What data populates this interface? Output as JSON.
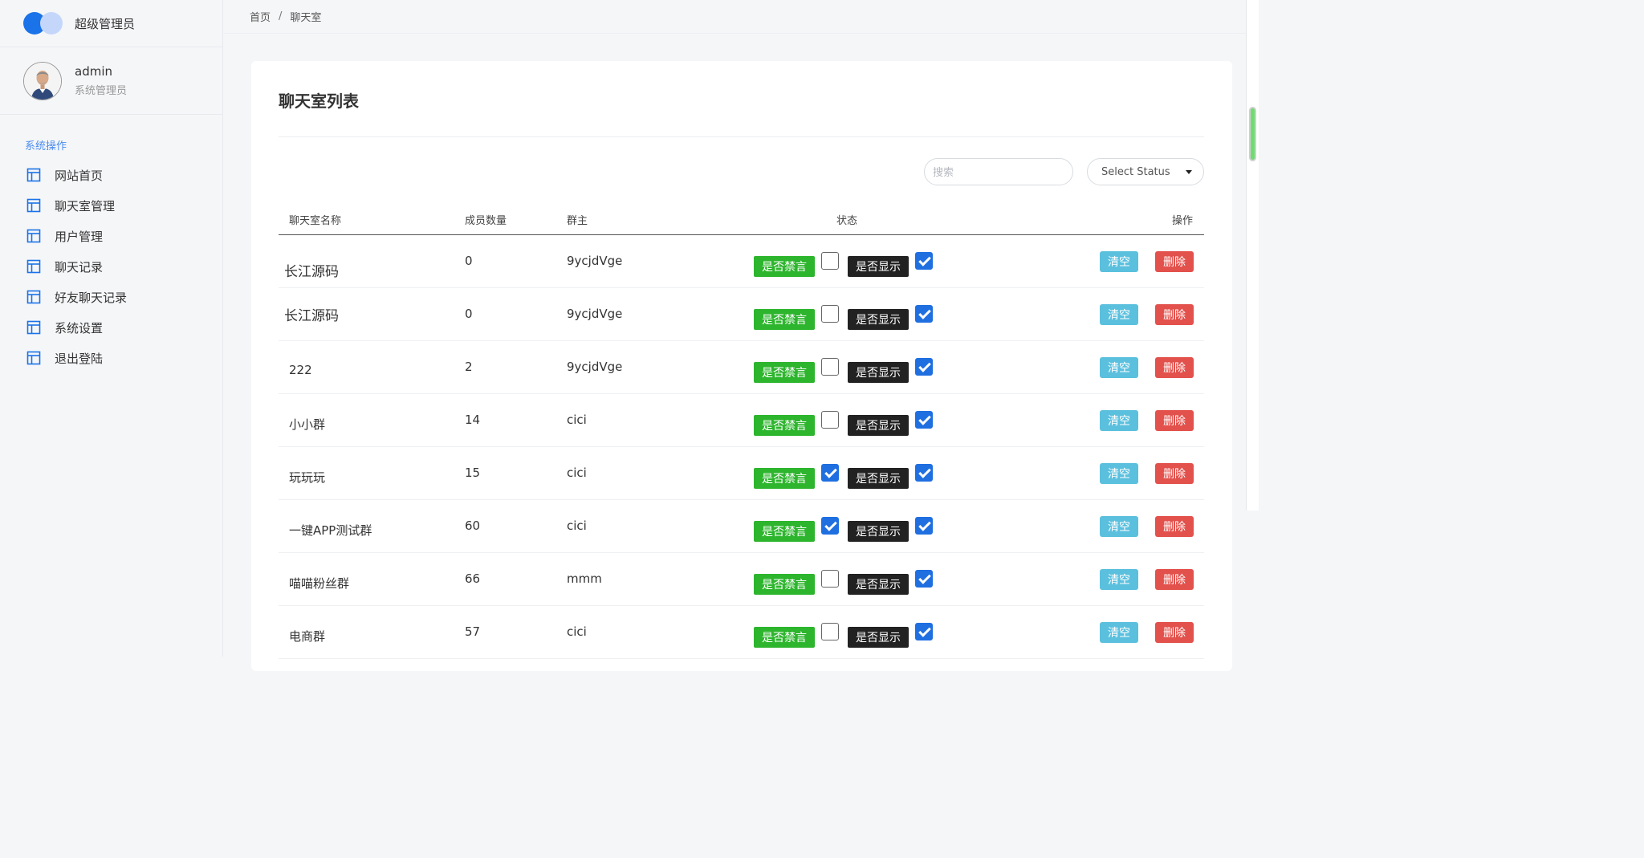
{
  "brand": {
    "name": "超级管理员"
  },
  "profile": {
    "name": "admin",
    "role": "系统管理员"
  },
  "sidebar": {
    "section_title": "系统操作",
    "items": [
      {
        "label": "网站首页"
      },
      {
        "label": "聊天室管理"
      },
      {
        "label": "用户管理"
      },
      {
        "label": "聊天记录"
      },
      {
        "label": "好友聊天记录"
      },
      {
        "label": "系统设置"
      },
      {
        "label": "退出登陆"
      }
    ]
  },
  "breadcrumb": {
    "home": "首页",
    "separator": "/",
    "current": "聊天室"
  },
  "page": {
    "title": "聊天室列表"
  },
  "filters": {
    "search_placeholder": "搜索",
    "status_select": "Select Status"
  },
  "table": {
    "headers": {
      "name": "聊天室名称",
      "members": "成员数量",
      "owner": "群主",
      "status": "状态",
      "actions": "操作"
    },
    "labels": {
      "ban": "是否禁言",
      "show": "是否显示",
      "clear": "清空",
      "delete": "删除"
    },
    "rows": [
      {
        "name": "长江源码",
        "members": "0",
        "owner": "9ycjdVge",
        "banned": false,
        "shown": true
      },
      {
        "name": "长江源码",
        "members": "0",
        "owner": "9ycjdVge",
        "banned": false,
        "shown": true
      },
      {
        "name": "222",
        "members": "2",
        "owner": "9ycjdVge",
        "banned": false,
        "shown": true
      },
      {
        "name": "小小群",
        "members": "14",
        "owner": "cici",
        "banned": false,
        "shown": true
      },
      {
        "name": "玩玩玩",
        "members": "15",
        "owner": "cici",
        "banned": true,
        "shown": true
      },
      {
        "name": "一键APP测试群",
        "members": "60",
        "owner": "cici",
        "banned": true,
        "shown": true
      },
      {
        "name": "喵喵粉丝群",
        "members": "66",
        "owner": "mmm",
        "banned": false,
        "shown": true
      },
      {
        "name": "电商群",
        "members": "57",
        "owner": "cici",
        "banned": false,
        "shown": true
      }
    ]
  },
  "colors": {
    "accent": "#1a73e8",
    "ban_badge": "#2db52d",
    "show_badge": "#222222",
    "clear_button": "#5bc0de",
    "delete_button": "#e3514c",
    "checkbox_on": "#1f6fe0"
  }
}
